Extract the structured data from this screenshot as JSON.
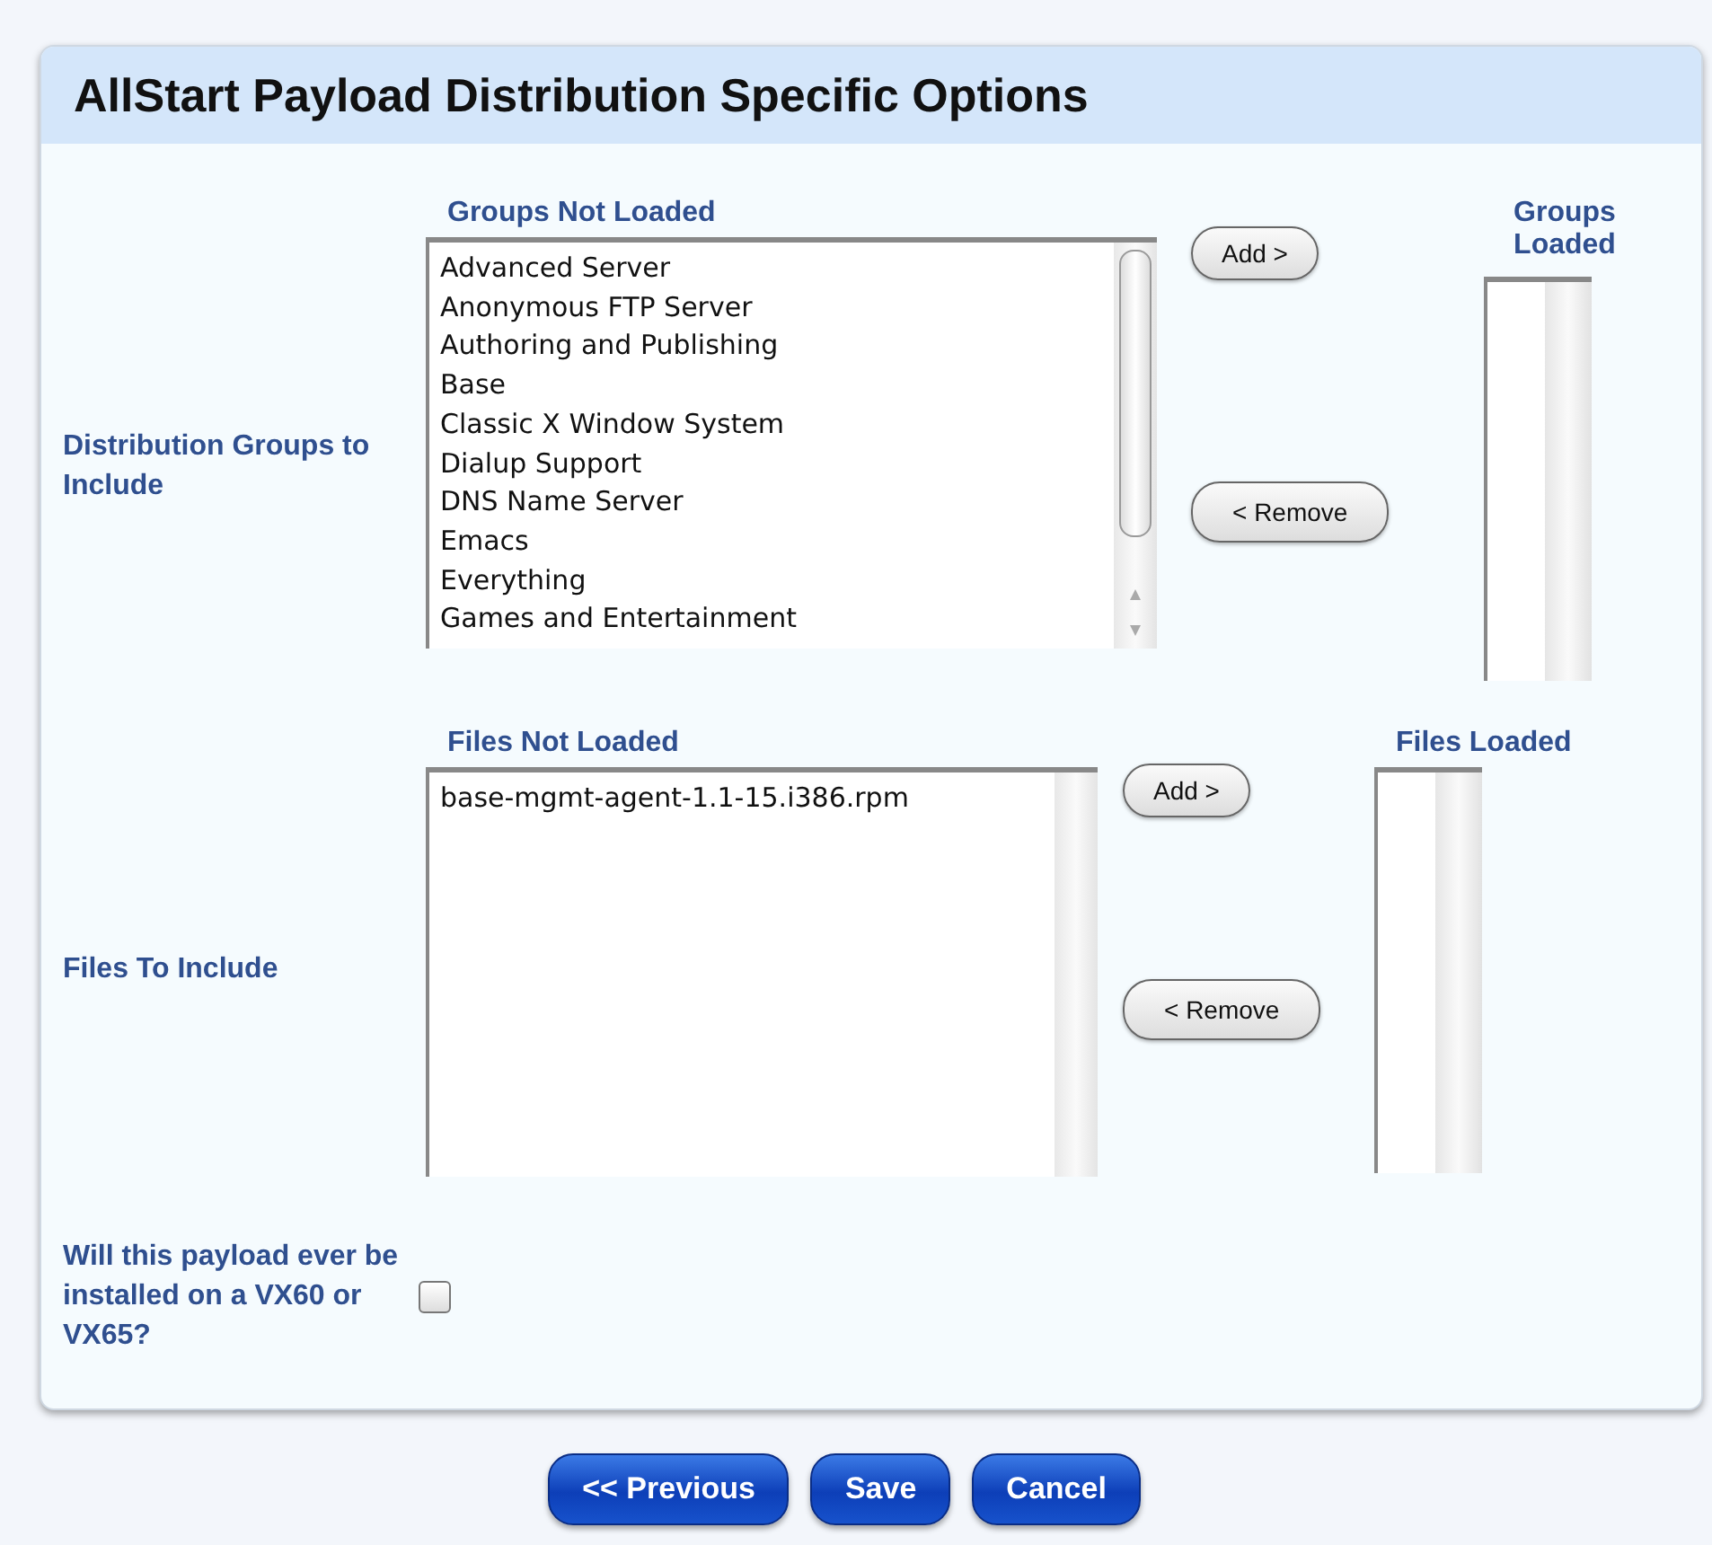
{
  "header": {
    "title": "AllStart Payload Distribution Specific Options"
  },
  "sections": [
    {
      "label": "Distribution Groups to Include",
      "available": {
        "heading": "Groups Not Loaded",
        "scrollable": true,
        "items": [
          "Advanced Server",
          "Anonymous FTP Server",
          "Authoring and Publishing",
          "Base",
          "Classic X Window System",
          "Dialup Support",
          "DNS Name Server",
          "Emacs",
          "Everything",
          "Games and Entertainment"
        ]
      },
      "add_button": "Add >",
      "remove_button": "< Remove",
      "loaded": {
        "heading": "Groups Loaded"
      }
    },
    {
      "label": "Files To Include",
      "available": {
        "heading": "Files Not Loaded",
        "scrollable": false,
        "items": [
          "base-mgmt-agent-1.1-15.i386.rpm"
        ]
      },
      "add_button": "Add >",
      "remove_button": "< Remove",
      "loaded": {
        "heading": "Files Loaded"
      }
    }
  ],
  "vx_option": {
    "label": "Will this payload ever be installed on a VX60 or VX65?",
    "checked": false
  },
  "buttons": [
    "<< Previous",
    "Save",
    "Cancel"
  ]
}
